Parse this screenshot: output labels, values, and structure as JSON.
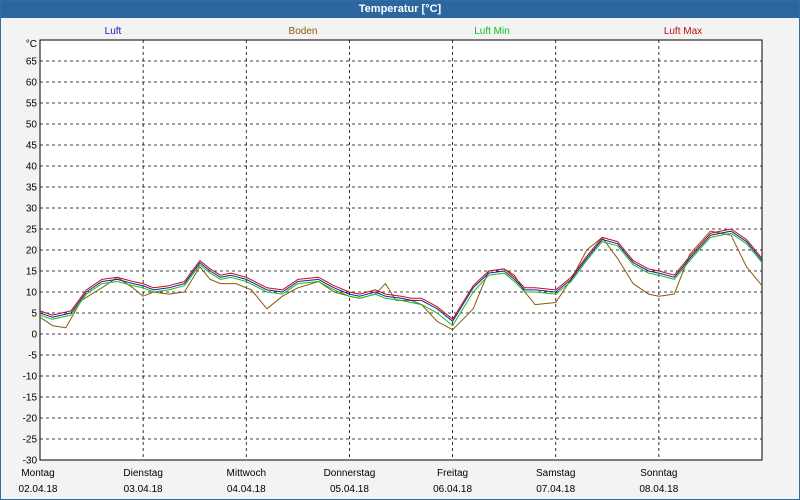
{
  "window": {
    "title": "Temperatur [°C]"
  },
  "chart_data": {
    "type": "line",
    "title": "Temperatur [°C]",
    "ylabel": "°C",
    "ylim": [
      -30,
      70
    ],
    "yticks": [
      -30,
      -25,
      -20,
      -15,
      -10,
      -5,
      0,
      5,
      10,
      15,
      20,
      25,
      30,
      35,
      40,
      45,
      50,
      55,
      60,
      65
    ],
    "x_tick_labels": [
      {
        "day": "Montag",
        "date": "02.04.18"
      },
      {
        "day": "Dienstag",
        "date": "03.04.18"
      },
      {
        "day": "Mittwoch",
        "date": "04.04.18"
      },
      {
        "day": "Donnerstag",
        "date": "05.04.18"
      },
      {
        "day": "Freitag",
        "date": "06.04.18"
      },
      {
        "day": "Samstag",
        "date": "07.04.18"
      },
      {
        "day": "Sonntag",
        "date": "08.04.18"
      }
    ],
    "xlim": [
      0,
      7
    ],
    "grid": true,
    "legend_position": "top",
    "series": [
      {
        "name": "Luft",
        "color": "#1a1ab0",
        "x": [
          0,
          0.12,
          0.3,
          0.45,
          0.6,
          0.75,
          0.9,
          1.0,
          1.1,
          1.25,
          1.4,
          1.55,
          1.65,
          1.75,
          1.85,
          2.0,
          2.2,
          2.35,
          2.5,
          2.7,
          2.85,
          3.0,
          3.1,
          3.25,
          3.35,
          3.5,
          3.6,
          3.7,
          3.85,
          4.0,
          4.2,
          4.35,
          4.5,
          4.6,
          4.7,
          4.8,
          5.0,
          5.15,
          5.3,
          5.45,
          5.6,
          5.75,
          5.9,
          6.0,
          6.15,
          6.3,
          6.5,
          6.7,
          6.85,
          7.0
        ],
        "y": [
          5,
          4,
          5,
          10,
          12.5,
          13,
          12,
          11.5,
          10.5,
          11,
          12,
          17,
          15,
          13.5,
          14,
          13,
          10.5,
          10,
          12.5,
          13,
          11,
          9.5,
          9,
          10,
          9,
          8.5,
          8,
          8,
          6,
          3,
          11,
          14.5,
          15,
          13,
          10.5,
          10.5,
          10,
          13,
          18,
          22.5,
          21.5,
          17,
          15,
          14.5,
          13.5,
          18,
          23.5,
          24.5,
          22,
          17.5
        ]
      },
      {
        "name": "Boden",
        "color": "#8a5a10",
        "x": [
          0,
          0.12,
          0.25,
          0.4,
          0.6,
          0.75,
          0.9,
          1.0,
          1.1,
          1.25,
          1.4,
          1.55,
          1.65,
          1.75,
          1.9,
          2.05,
          2.2,
          2.35,
          2.5,
          2.7,
          2.85,
          3.0,
          3.1,
          3.25,
          3.35,
          3.45,
          3.6,
          3.7,
          3.85,
          4.0,
          4.2,
          4.35,
          4.5,
          4.6,
          4.7,
          4.8,
          5.0,
          5.15,
          5.3,
          5.45,
          5.6,
          5.75,
          5.9,
          6.0,
          6.15,
          6.3,
          6.5,
          6.7,
          6.85,
          7.0
        ],
        "y": [
          4,
          2,
          1.5,
          8,
          11,
          13.5,
          11,
          9,
          10,
          9.5,
          10,
          16,
          13,
          12,
          12,
          10.5,
          6,
          9,
          11,
          12.5,
          10,
          9,
          8.5,
          9.5,
          12,
          8,
          8,
          7,
          3,
          1,
          6,
          15,
          15.5,
          14,
          10,
          7,
          7.5,
          13,
          20,
          23,
          18,
          12,
          9.5,
          9,
          9.5,
          19,
          24.5,
          23.5,
          16,
          11.5
        ]
      },
      {
        "name": "Luft Min",
        "color": "#10c010",
        "x": [
          0,
          0.12,
          0.3,
          0.45,
          0.6,
          0.75,
          0.9,
          1.0,
          1.1,
          1.25,
          1.4,
          1.55,
          1.65,
          1.75,
          1.85,
          2.0,
          2.2,
          2.35,
          2.5,
          2.7,
          2.85,
          3.0,
          3.1,
          3.25,
          3.35,
          3.5,
          3.6,
          3.7,
          3.85,
          4.0,
          4.2,
          4.35,
          4.5,
          4.6,
          4.7,
          4.8,
          5.0,
          5.15,
          5.3,
          5.45,
          5.6,
          5.75,
          5.9,
          6.0,
          6.15,
          6.3,
          6.5,
          6.7,
          6.85,
          7.0
        ],
        "y": [
          4.5,
          3.5,
          4.5,
          9.5,
          12,
          12.5,
          11.5,
          11,
          10,
          10.5,
          11.5,
          16.5,
          14.5,
          13,
          13.5,
          12.5,
          10,
          9.5,
          12,
          12.5,
          10.5,
          9,
          8.5,
          9.5,
          8.5,
          8,
          7.5,
          7,
          5,
          2,
          10,
          14,
          14.5,
          12.5,
          10,
          10,
          9.5,
          12.5,
          17.5,
          22,
          21,
          16.5,
          14.5,
          14,
          13,
          17.5,
          23,
          24,
          21.5,
          17
        ]
      },
      {
        "name": "Luft Max",
        "color": "#c01010",
        "x": [
          0,
          0.12,
          0.3,
          0.45,
          0.6,
          0.75,
          0.9,
          1.0,
          1.1,
          1.25,
          1.4,
          1.55,
          1.65,
          1.75,
          1.85,
          2.0,
          2.2,
          2.35,
          2.5,
          2.7,
          2.85,
          3.0,
          3.1,
          3.25,
          3.35,
          3.5,
          3.6,
          3.7,
          3.85,
          4.0,
          4.2,
          4.35,
          4.5,
          4.6,
          4.7,
          4.8,
          5.0,
          5.15,
          5.3,
          5.45,
          5.6,
          5.75,
          5.9,
          6.0,
          6.15,
          6.3,
          6.5,
          6.7,
          6.85,
          7.0
        ],
        "y": [
          5.5,
          4.5,
          5.5,
          10.5,
          13,
          13.5,
          12.5,
          12,
          11,
          11.5,
          12.5,
          17.5,
          15.5,
          14,
          14.5,
          13.5,
          11,
          10.5,
          13,
          13.5,
          11.5,
          10,
          9.5,
          10.5,
          9.5,
          9,
          8.5,
          8.5,
          6.5,
          3.5,
          11.5,
          15,
          15.5,
          13.5,
          11,
          11,
          10.5,
          13.5,
          18.5,
          23,
          22,
          17.5,
          15.5,
          15,
          14,
          18.5,
          24,
          25,
          22.5,
          18
        ]
      }
    ]
  }
}
